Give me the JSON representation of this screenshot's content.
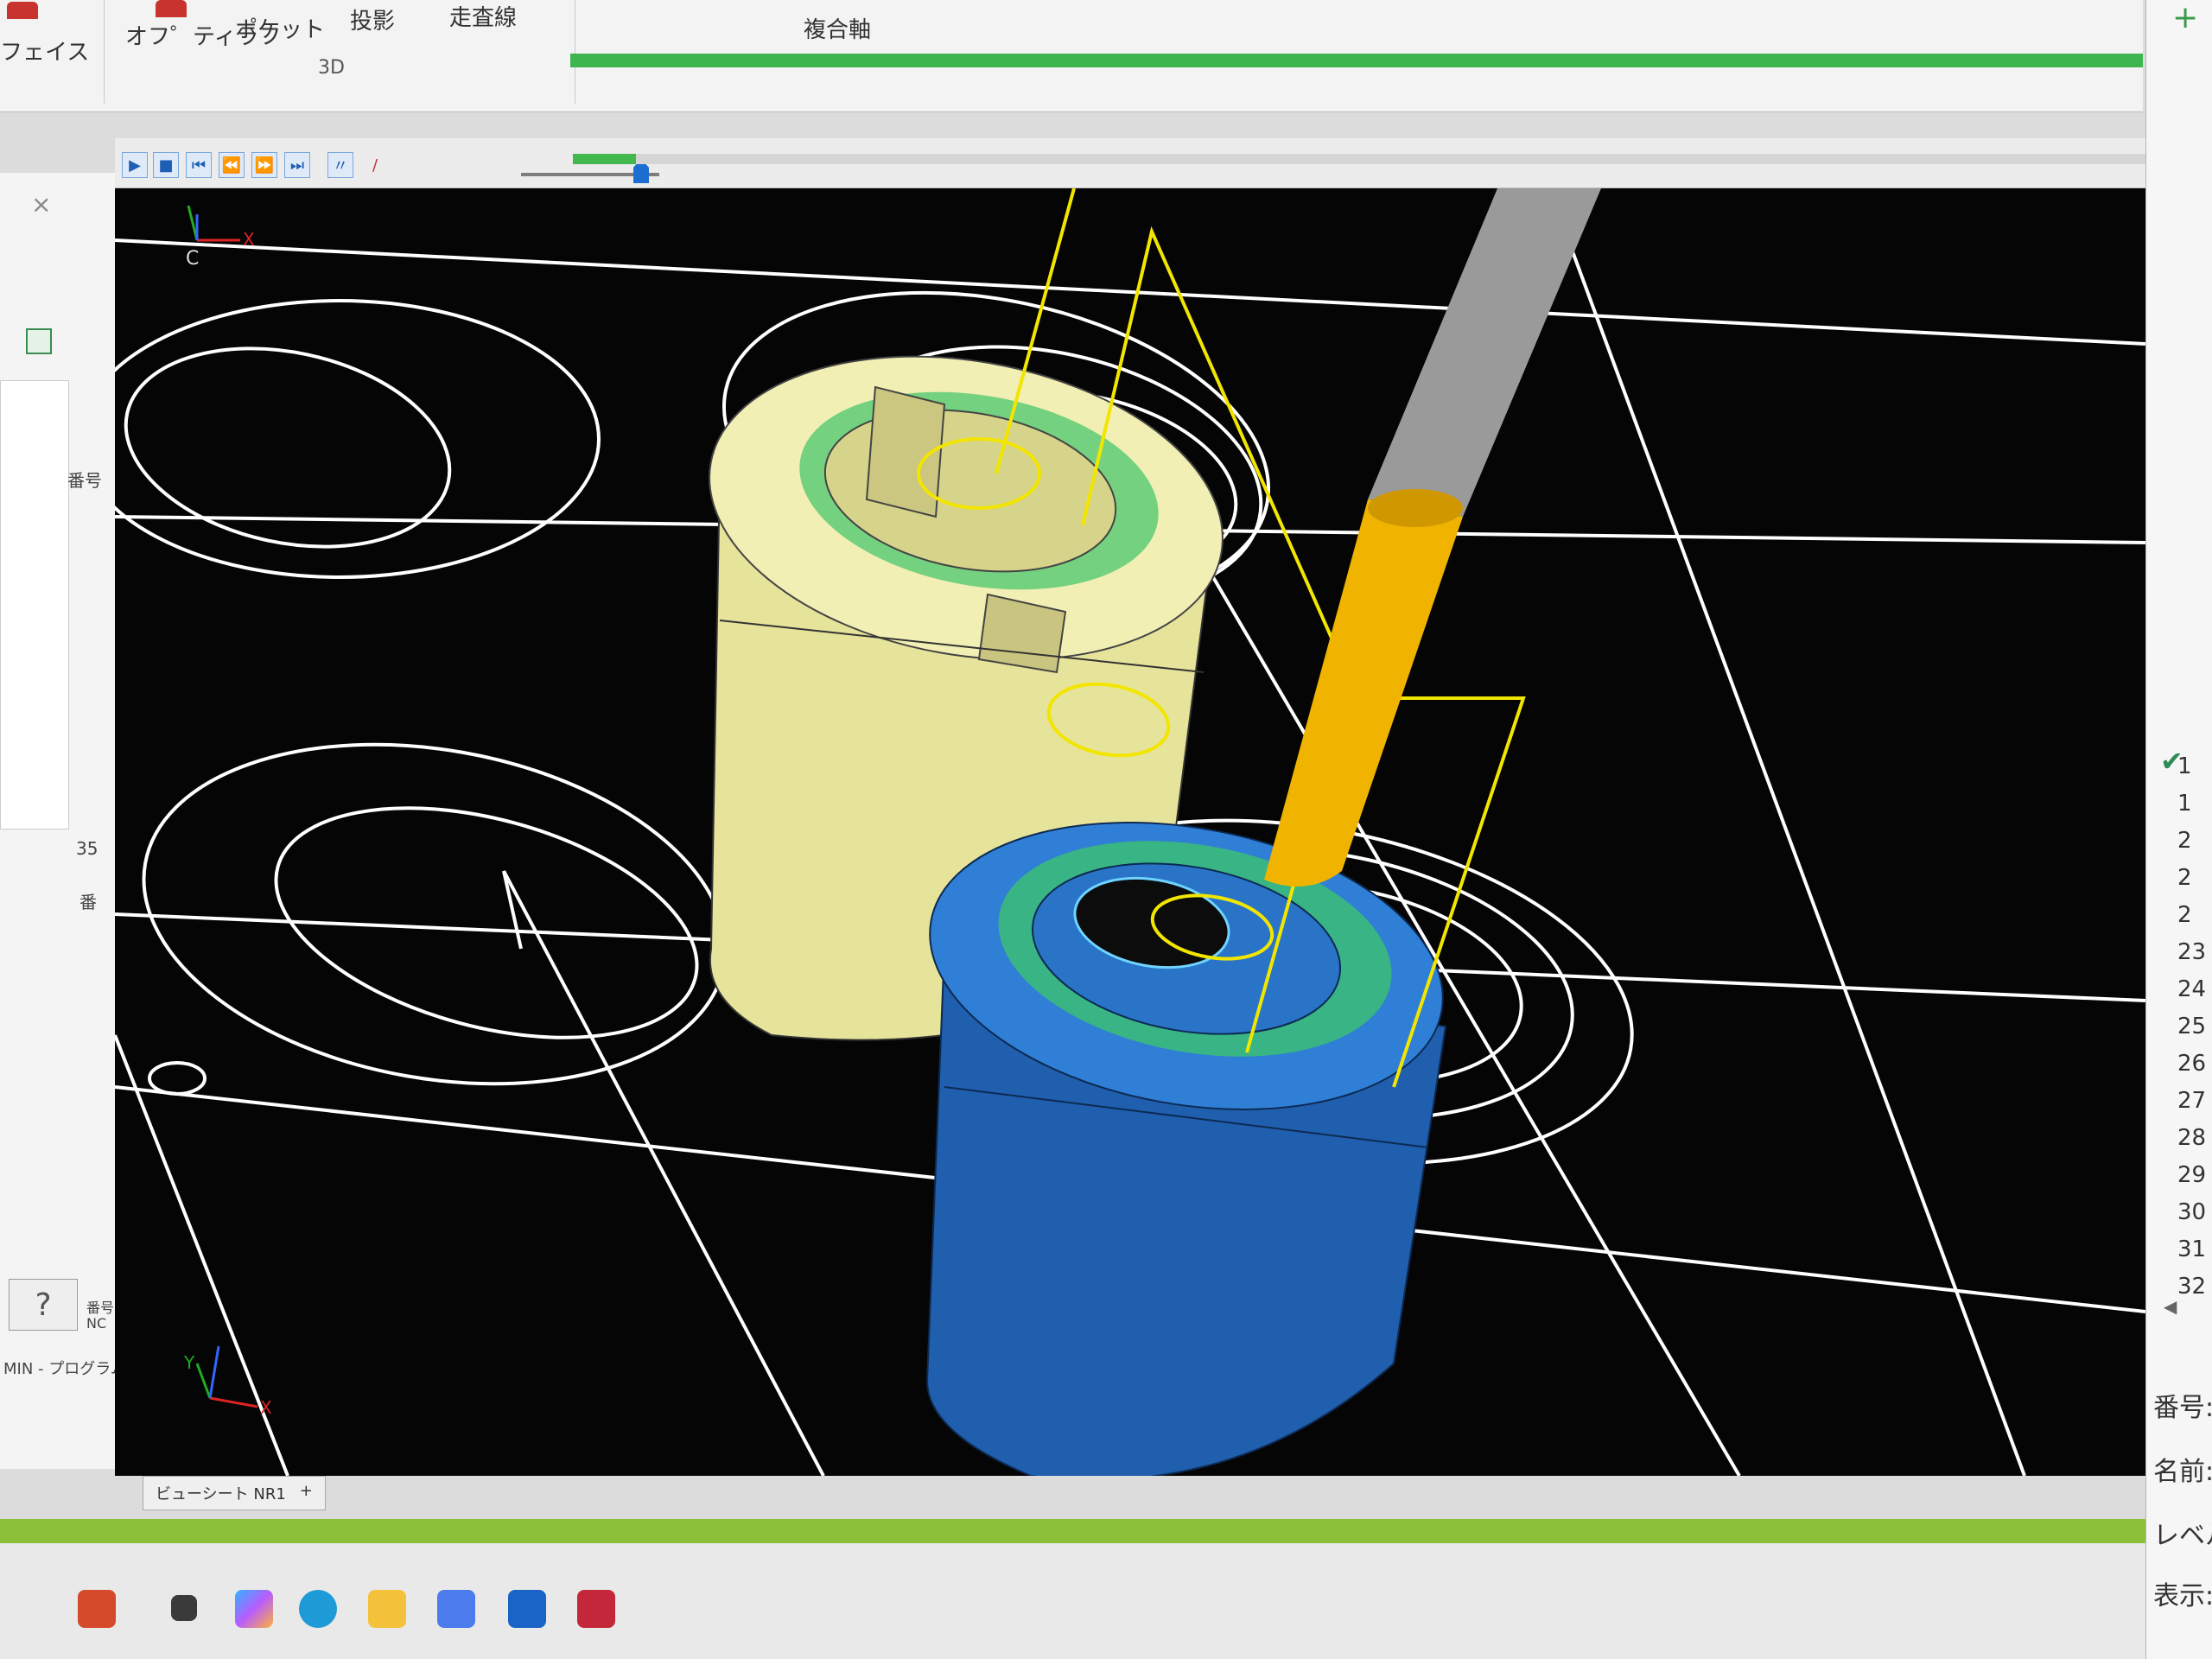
{
  "ribbon": {
    "buttons": [
      {
        "label": "フェイス"
      },
      {
        "label": "オフ゜ティラフ"
      },
      {
        "label": "ポケット"
      },
      {
        "label": "投影"
      },
      {
        "label": "走査線"
      },
      {
        "label": "複合軸"
      }
    ],
    "group_label": "3D",
    "accent_color": "#3fb550"
  },
  "toolbar": {
    "icons": [
      "play-icon",
      "stop-icon",
      "skip-start-icon",
      "step-back-icon",
      "step-forward-icon",
      "skip-end-icon",
      "toolpath-icon",
      "pen-icon"
    ],
    "progress_fraction": 0.04
  },
  "left_panel": {
    "labels": [
      "番号",
      "35",
      "番",
      "番号",
      "NC",
      "MIN - プログラム名"
    ]
  },
  "viewport": {
    "axes_top": {
      "x": "X",
      "c": "C"
    },
    "axes_bottom": {
      "x": "X",
      "y": "Y"
    },
    "colors": {
      "background": "#050505",
      "toolpath": "#ffffff",
      "tool_motion": "#f2e600",
      "finished_part": "#e6e39a",
      "stock_part": "#2a6fc2",
      "cut_surface": "#3ec56a",
      "tool_shank": "#9a9a9a",
      "tool_cutter": "#f0b400"
    }
  },
  "sheet_tab": {
    "label": "ビューシート NR1",
    "add": "+"
  },
  "right_panel": {
    "list_numbers": [
      "1",
      "1",
      "2",
      "2",
      "2",
      "23",
      "24",
      "25",
      "26",
      "27",
      "28",
      "29",
      "30",
      "31",
      "32"
    ],
    "fields": [
      "番号:",
      "名前:",
      "レベルセット",
      "表示:"
    ]
  },
  "taskbar": {
    "icons": [
      "app-logo-icon",
      "task-view-icon",
      "copilot-icon",
      "edge-icon",
      "folder-icon",
      "store-icon",
      "outlook-icon",
      "cam-app-icon"
    ]
  }
}
